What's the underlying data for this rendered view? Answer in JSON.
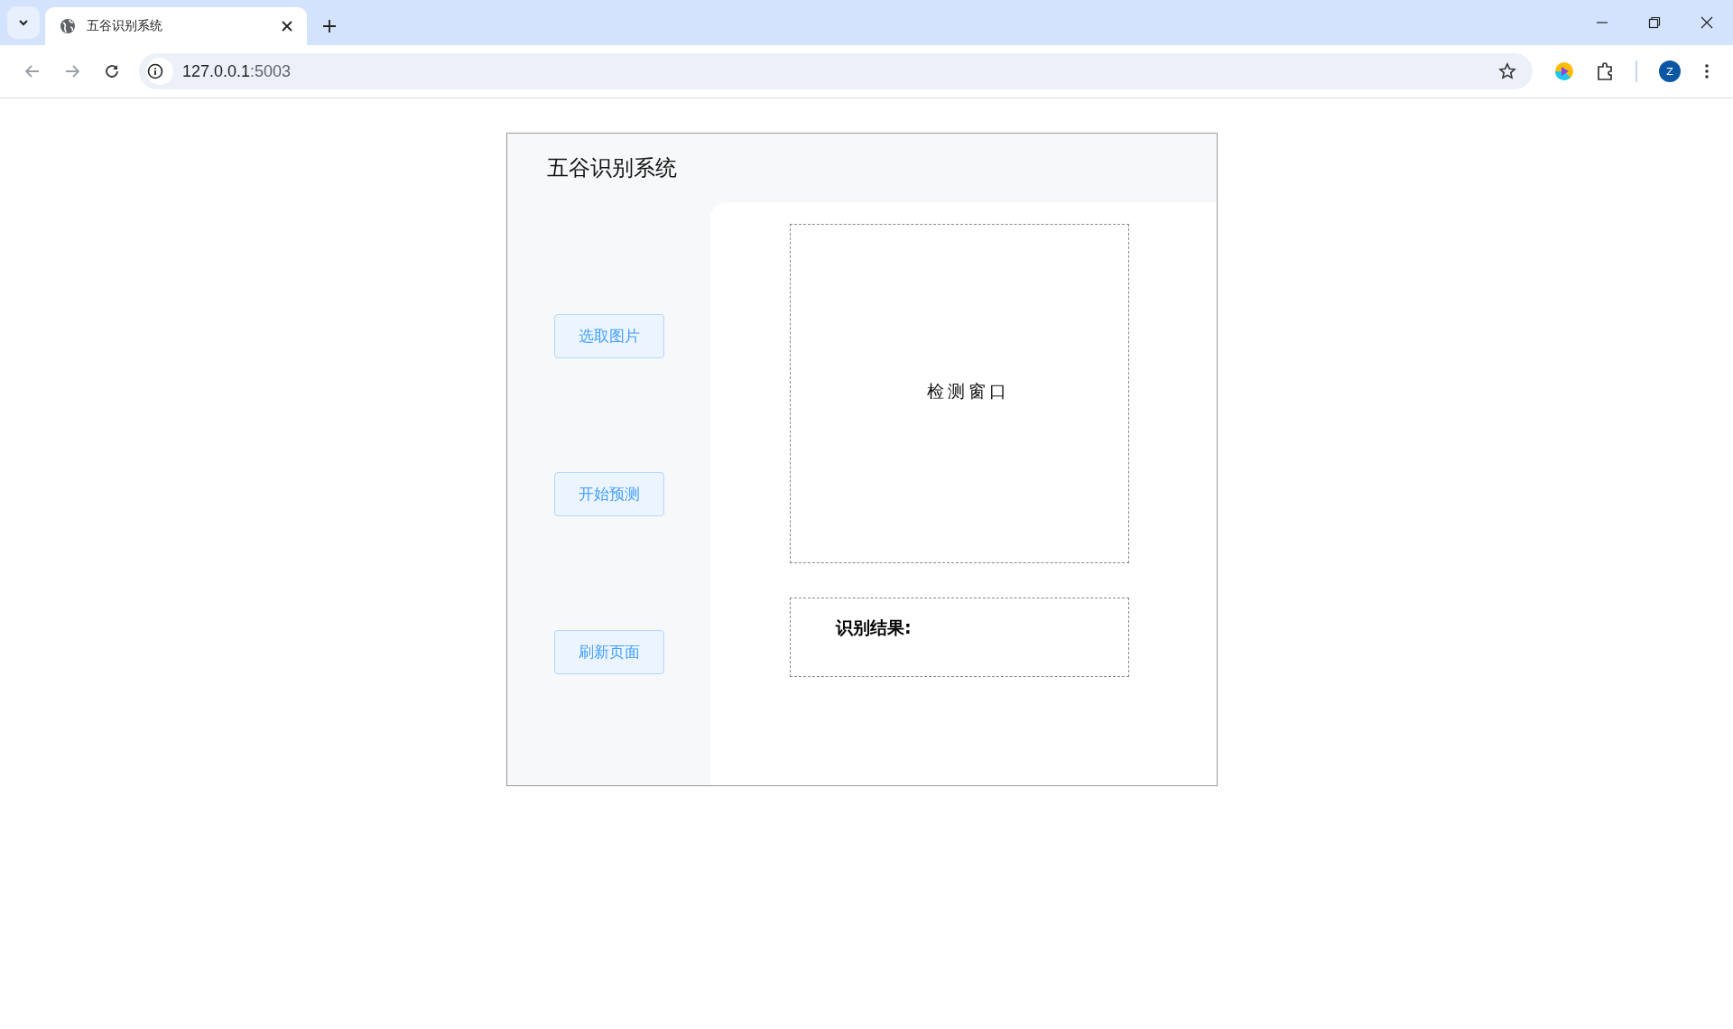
{
  "browser": {
    "tab": {
      "title": "五谷识别系统",
      "selected": true
    },
    "url": {
      "host": "127.0.0.1",
      "port": ":5003"
    },
    "profile": {
      "initial": "Z"
    }
  },
  "app": {
    "title": "五谷识别系统",
    "buttons": [
      {
        "label": "选取图片"
      },
      {
        "label": "开始预测"
      },
      {
        "label": "刷新页面"
      }
    ],
    "detection_window": {
      "label": "检测窗口"
    },
    "result": {
      "label": "识别结果:"
    }
  }
}
